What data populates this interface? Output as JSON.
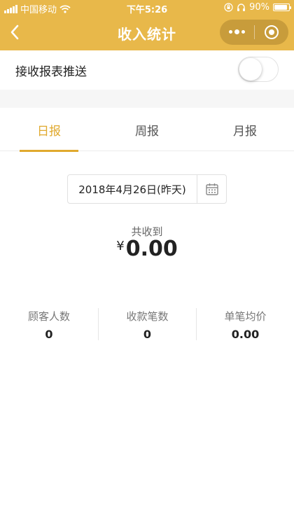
{
  "status_bar": {
    "carrier": "中国移动",
    "time": "下午5:26",
    "battery": "90%",
    "battery_level": 0.9
  },
  "nav": {
    "title": "收入统计"
  },
  "push": {
    "label": "接收报表推送",
    "enabled": false
  },
  "tabs": [
    {
      "label": "日报",
      "active": true
    },
    {
      "label": "周报",
      "active": false
    },
    {
      "label": "月报",
      "active": false
    }
  ],
  "date_picker": {
    "value": "2018年4月26日(昨天)"
  },
  "summary": {
    "total_label": "共收到",
    "currency_symbol": "¥",
    "total_value": "0.00"
  },
  "stats": [
    {
      "label": "顾客人数",
      "value": "0"
    },
    {
      "label": "收款笔数",
      "value": "0"
    },
    {
      "label": "单笔均价",
      "value": "0.00"
    }
  ],
  "colors": {
    "header": "#e8b84a",
    "accent": "#e0a92e"
  }
}
